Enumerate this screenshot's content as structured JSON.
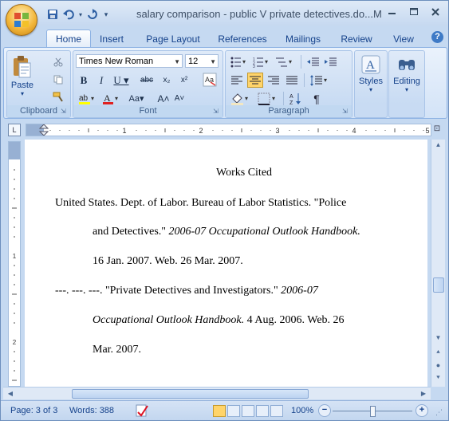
{
  "window": {
    "title": "salary comparison - public V private detectives.do...M",
    "controls": [
      "minimize",
      "maximize",
      "close"
    ]
  },
  "qat": {
    "save_icon": "save-icon",
    "undo_icon": "undo-icon",
    "redo_icon": "redo-icon",
    "customize_icon": "qat-dropdown-icon"
  },
  "tabs": [
    {
      "label": "Home",
      "active": true
    },
    {
      "label": "Insert"
    },
    {
      "label": "Page Layout"
    },
    {
      "label": "References"
    },
    {
      "label": "Mailings"
    },
    {
      "label": "Review"
    },
    {
      "label": "View"
    }
  ],
  "ribbon": {
    "clipboard": {
      "label": "Clipboard",
      "paste": "Paste"
    },
    "font": {
      "label": "Font",
      "font_name": "Times New Roman",
      "font_size": "12"
    },
    "paragraph": {
      "label": "Paragraph"
    },
    "styles": {
      "label": "Styles"
    },
    "editing": {
      "label": "Editing"
    }
  },
  "document": {
    "lines": [
      {
        "segments": [
          {
            "text": "Works Cited",
            "italic": false
          }
        ]
      },
      {
        "segments": [
          {
            "text": "United States. Dept. of Labor. Bureau of Labor Statistics. \"Police",
            "italic": false
          }
        ]
      },
      {
        "segments": [
          {
            "text": "and Detectives.\" ",
            "italic": false
          },
          {
            "text": "2006-07 Occupational Outlook Handbook.",
            "italic": true
          }
        ]
      },
      {
        "segments": [
          {
            "text": "16 Jan. 2007. Web. 26 Mar. 2007.",
            "italic": false
          }
        ]
      },
      {
        "segments": [
          {
            "text": "---. ---. ---. \"Private Detectives and Investigators.\" ",
            "italic": false
          },
          {
            "text": "2006-07",
            "italic": true
          }
        ]
      },
      {
        "segments": [
          {
            "text": "Occupational Outlook Handbook.",
            "italic": true
          },
          {
            "text": " 4 Aug. 2006. Web. 26",
            "italic": false
          }
        ]
      },
      {
        "segments": [
          {
            "text": "Mar. 2007.",
            "italic": false
          }
        ]
      }
    ]
  },
  "status": {
    "page": "Page: 3 of 3",
    "words": "Words: 388",
    "zoom": "100%",
    "zoom_minus": "−",
    "zoom_plus": "+"
  },
  "ruler_numbers": [
    "1",
    "2",
    "3",
    "4",
    "5"
  ]
}
